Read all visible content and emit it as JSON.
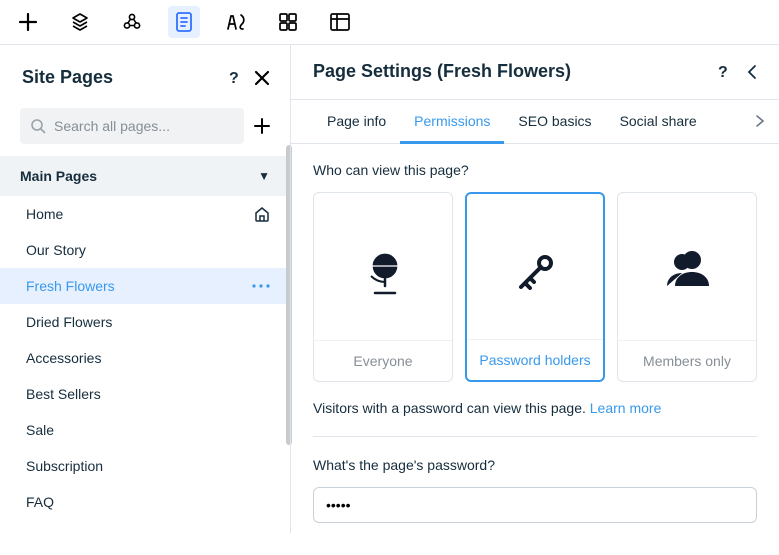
{
  "toolbar": {
    "icons": [
      "plus-icon",
      "plugin-icon",
      "product-icon",
      "page-icon",
      "theme-icon",
      "apps-icon",
      "data-icon"
    ]
  },
  "sitePages": {
    "title": "Site Pages",
    "search": {
      "placeholder": "Search all pages..."
    },
    "group": {
      "label": "Main Pages"
    },
    "items": [
      {
        "label": "Home",
        "active": false,
        "home": true
      },
      {
        "label": "Our Story",
        "active": false
      },
      {
        "label": "Fresh Flowers",
        "active": true,
        "more": true
      },
      {
        "label": "Dried Flowers",
        "active": false
      },
      {
        "label": "Accessories",
        "active": false
      },
      {
        "label": "Best Sellers",
        "active": false
      },
      {
        "label": "Sale",
        "active": false
      },
      {
        "label": "Subscription",
        "active": false
      },
      {
        "label": "FAQ",
        "active": false
      }
    ]
  },
  "pageSettings": {
    "title": "Page Settings (Fresh Flowers)",
    "tabs": [
      {
        "label": "Page info",
        "active": false
      },
      {
        "label": "Permissions",
        "active": true
      },
      {
        "label": "SEO basics",
        "active": false
      },
      {
        "label": "Social share",
        "active": false
      }
    ],
    "permissions": {
      "question": "Who can view this page?",
      "options": [
        {
          "label": "Everyone",
          "icon": "globe-icon",
          "selected": false
        },
        {
          "label": "Password holders",
          "icon": "key-icon",
          "selected": true
        },
        {
          "label": "Members only",
          "icon": "members-icon",
          "selected": false
        }
      ],
      "helper": "Visitors with a password can view this page.",
      "learnMore": "Learn more",
      "passwordLabel": "What's the page's password?",
      "passwordValue": "•••••"
    }
  }
}
